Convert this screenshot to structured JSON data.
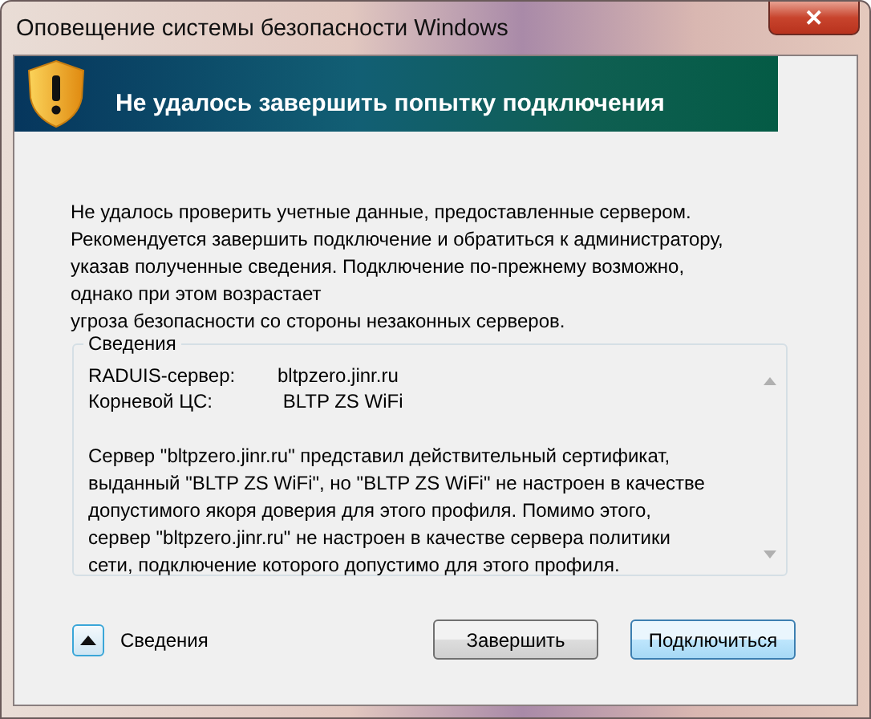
{
  "window": {
    "title": "Оповещение системы безопасности Windows",
    "close_label": "✕"
  },
  "banner": {
    "title": "Не удалось завершить попытку подключения"
  },
  "message_lines": [
    "Не удалось проверить учетные данные, предоставленные сервером.",
    "Рекомендуется завершить подключение и обратиться к администратору,",
    "указав полученные сведения. Подключение по-прежнему возможно,",
    "однако при этом возрастает",
    "угроза безопасности со стороны незаконных серверов."
  ],
  "details": {
    "legend": "Сведения",
    "fields": [
      {
        "label": "RADUIS-сервер:",
        "value": "bltpzero.jinr.ru"
      },
      {
        "label": "Корневой ЦС:",
        "value": " BLTP ZS WiFi"
      }
    ],
    "text_lines": [
      "Сервер \"bltpzero.jinr.ru\" представил действительный сертификат,",
      "выданный \"BLTP ZS WiFi\", но \"BLTP ZS WiFi\" не настроен в качестве",
      "допустимого якоря доверия для этого профиля. Помимо этого,",
      "сервер \"bltpzero.jinr.ru\" не настроен в качестве сервера политики",
      "сети, подключение которого допустимо для этого профиля."
    ]
  },
  "toggle": {
    "label": "Сведения",
    "expanded": true
  },
  "buttons": [
    {
      "label": "Завершить",
      "default": false
    },
    {
      "label": "Подключиться",
      "default": true
    }
  ]
}
